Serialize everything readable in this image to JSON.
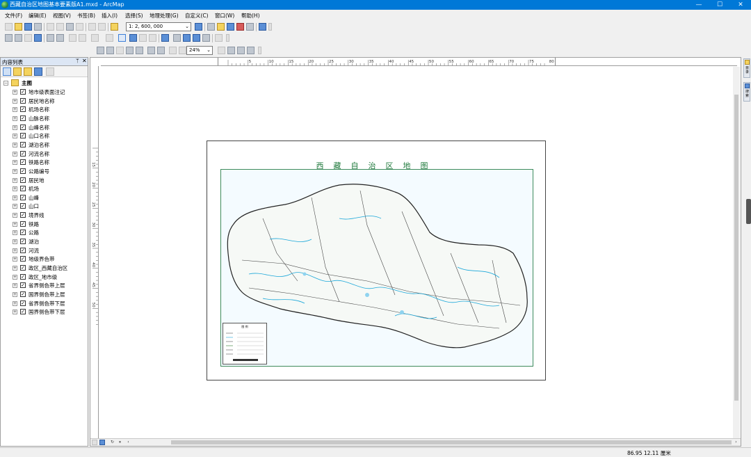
{
  "window": {
    "title": "西藏自治区地图基本要素版A1.mxd - ArcMap",
    "minimize": "—",
    "maximize": "☐",
    "close": "✕"
  },
  "menu": [
    "文件(F)",
    "编辑(E)",
    "视图(V)",
    "书签(B)",
    "插入(I)",
    "选择(S)",
    "地理处理(G)",
    "自定义(C)",
    "窗口(W)",
    "帮助(H)"
  ],
  "toolbar": {
    "scale": "1: 2, 600, 000",
    "zoom": "24%"
  },
  "toc": {
    "title": "内容列表",
    "pin": "ᛘ",
    "close": "✕",
    "root": "主图",
    "layers": [
      "地市级表面注记",
      "居民地名称",
      "机场名称",
      "山脉名称",
      "山峰名称",
      "山口名称",
      "湖泊名称",
      "河流名称",
      "铁路名称",
      "公路编号",
      "居民地",
      "机场",
      "山峰",
      "山口",
      "境界线",
      "铁路",
      "公路",
      "湖泊",
      "河流",
      "地级界色带",
      "政区_西藏自治区",
      "政区_地市级",
      "省界侧色带上层",
      "国界侧色带上层",
      "省界侧色带下层",
      "国界侧色带下层"
    ]
  },
  "ruler": {
    "h_ticks": [
      "5",
      "10",
      "15",
      "20",
      "25",
      "30",
      "35",
      "40",
      "45",
      "50",
      "55",
      "60",
      "65",
      "70",
      "75",
      "80"
    ],
    "v_ticks": [
      "15",
      "20",
      "25",
      "30",
      "35",
      "40",
      "45",
      "50"
    ]
  },
  "map": {
    "title": "西藏自治区地图",
    "legend_title": "图 例"
  },
  "right_dock": [
    "目录",
    "搜索"
  ],
  "status": {
    "coords": "86.95  12.11 厘米"
  },
  "colors": {
    "titlebar": "#0078d7",
    "map_title": "#1f7a3c",
    "frame": "#3d8a5b",
    "water": "#1aa7d9"
  }
}
